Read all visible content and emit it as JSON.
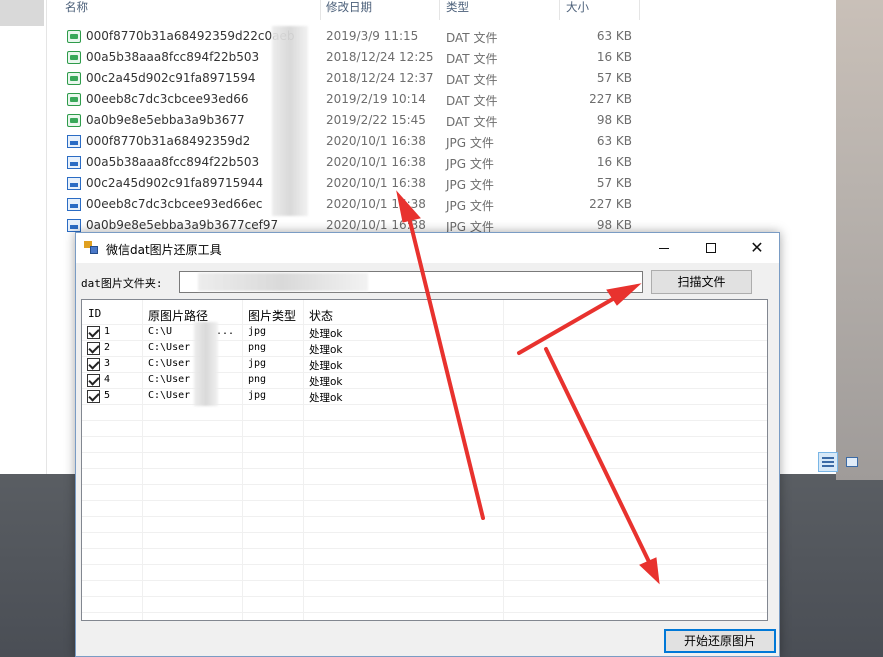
{
  "explorer": {
    "columns": {
      "name": "名称",
      "date": "修改日期",
      "type": "类型",
      "size": "大小"
    },
    "files": [
      {
        "icon": "dat-file-icon",
        "kind": "dat",
        "name": "000f8770b31a68492359d22c0aeb",
        "date": "2019/3/9 11:15",
        "type": "DAT 文件",
        "size": "63 KB"
      },
      {
        "icon": "dat-file-icon",
        "kind": "dat",
        "name": "00a5b38aaa8fcc894f22b503",
        "date": "2018/12/24 12:25",
        "type": "DAT 文件",
        "size": "16 KB"
      },
      {
        "icon": "dat-file-icon",
        "kind": "dat",
        "name": "00c2a45d902c91fa8971594",
        "date": "2018/12/24 12:37",
        "type": "DAT 文件",
        "size": "57 KB"
      },
      {
        "icon": "dat-file-icon",
        "kind": "dat",
        "name": "00eeb8c7dc3cbcee93ed66",
        "date": "2019/2/19 10:14",
        "type": "DAT 文件",
        "size": "227 KB"
      },
      {
        "icon": "dat-file-icon",
        "kind": "dat",
        "name": "0a0b9e8e5ebba3a9b3677",
        "date": "2019/2/22 15:45",
        "type": "DAT 文件",
        "size": "98 KB"
      },
      {
        "icon": "jpg-file-icon",
        "kind": "jpg",
        "name": "000f8770b31a68492359d2",
        "date": "2020/10/1 16:38",
        "type": "JPG 文件",
        "size": "63 KB"
      },
      {
        "icon": "jpg-file-icon",
        "kind": "jpg",
        "name": "00a5b38aaa8fcc894f22b503",
        "date": "2020/10/1 16:38",
        "type": "JPG 文件",
        "size": "16 KB"
      },
      {
        "icon": "jpg-file-icon",
        "kind": "jpg",
        "name": "00c2a45d902c91fa89715944",
        "date": "2020/10/1 16:38",
        "type": "JPG 文件",
        "size": "57 KB"
      },
      {
        "icon": "jpg-file-icon",
        "kind": "jpg",
        "name": "00eeb8c7dc3cbcee93ed66ec",
        "date": "2020/10/1 16:38",
        "type": "JPG 文件",
        "size": "227 KB"
      },
      {
        "icon": "jpg-file-icon",
        "kind": "jpg",
        "name": "0a0b9e8e5ebba3a9b3677cef97",
        "date": "2020/10/1 16:38",
        "type": "JPG 文件",
        "size": "98 KB"
      }
    ]
  },
  "dialog": {
    "title": "微信dat图片还原工具",
    "folder_label": "dat图片文件夹:",
    "folder_value": "",
    "scan_button": "扫描文件",
    "start_button": "开始还原图片",
    "grid_headers": {
      "id": "ID",
      "path": "原图片路径",
      "type": "图片类型",
      "status": "状态"
    },
    "rows": [
      {
        "id": "1",
        "path": "C:\\U",
        "path_tail": "...",
        "type": "jpg",
        "status": "处理ok"
      },
      {
        "id": "2",
        "path": "C:\\User",
        "path_tail": "",
        "type": "png",
        "status": "处理ok"
      },
      {
        "id": "3",
        "path": "C:\\User",
        "path_tail": "",
        "type": "jpg",
        "status": "处理ok"
      },
      {
        "id": "4",
        "path": "C:\\User",
        "path_tail": "",
        "type": "png",
        "status": "处理ok"
      },
      {
        "id": "5",
        "path": "C:\\User",
        "path_tail": "",
        "type": "jpg",
        "status": "处理ok"
      }
    ]
  },
  "colors": {
    "arrow": "#e8322e",
    "accent": "#0078d7"
  }
}
